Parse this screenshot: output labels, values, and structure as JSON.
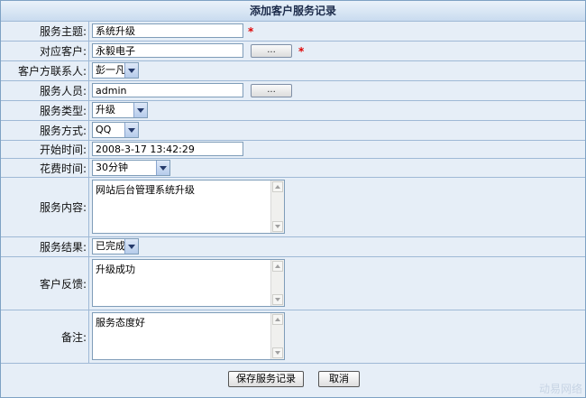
{
  "form": {
    "title": "添加客户服务记录",
    "subject": {
      "label": "服务主题:",
      "value": "系统升级",
      "required_mark": "*"
    },
    "customer": {
      "label": "对应客户:",
      "value": "永毅电子",
      "picker_label": "...",
      "required_mark": "*"
    },
    "contact": {
      "label": "客户方联系人:",
      "value": "彭一凡"
    },
    "staff": {
      "label": "服务人员:",
      "value": "admin",
      "picker_label": "..."
    },
    "service_type": {
      "label": "服务类型:",
      "value": "升级"
    },
    "service_method": {
      "label": "服务方式:",
      "value": "QQ"
    },
    "start_time": {
      "label": "开始时间:",
      "value": "2008-3-17 13:42:29"
    },
    "duration": {
      "label": "花费时间:",
      "value": "30分钟"
    },
    "content": {
      "label": "服务内容:",
      "value": "网站后台管理系统升级"
    },
    "result": {
      "label": "服务结果:",
      "value": "已完成"
    },
    "feedback": {
      "label": "客户反馈:",
      "value": "升级成功"
    },
    "remark": {
      "label": "备注:",
      "value": "服务态度好"
    },
    "save_label": "保存服务记录",
    "cancel_label": "取消"
  },
  "watermark": "动易网络",
  "colors": {
    "required": "#e00000",
    "panel_bg": "#e6eef7",
    "border": "#9fb9d6"
  }
}
